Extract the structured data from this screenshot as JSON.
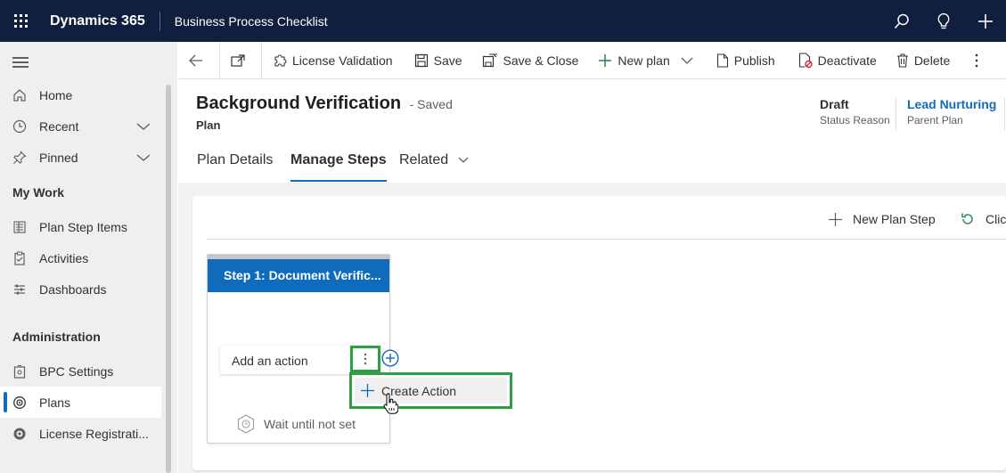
{
  "topbar": {
    "brand": "Dynamics 365",
    "app_title": "Business Process Checklist",
    "icons": [
      "search-icon",
      "lightbulb-icon",
      "plus-icon"
    ]
  },
  "sidebar": {
    "items_top": [
      {
        "label": "Home",
        "icon": "home-icon"
      },
      {
        "label": "Recent",
        "icon": "clock-icon",
        "expandable": true
      },
      {
        "label": "Pinned",
        "icon": "pin-icon",
        "expandable": true
      }
    ],
    "section_my_work": "My Work",
    "items_my_work": [
      {
        "label": "Plan Step Items",
        "icon": "list-icon"
      },
      {
        "label": "Activities",
        "icon": "clipboard-icon"
      },
      {
        "label": "Dashboards",
        "icon": "dashboard-icon"
      }
    ],
    "section_admin": "Administration",
    "items_admin": [
      {
        "label": "BPC Settings",
        "icon": "settings-icon"
      },
      {
        "label": "Plans",
        "icon": "plan-icon",
        "selected": true
      },
      {
        "label": "License Registrati...",
        "icon": "license-icon"
      }
    ]
  },
  "commandbar": {
    "license_validation": "License Validation",
    "save": "Save",
    "save_close": "Save & Close",
    "new_plan": "New plan",
    "publish": "Publish",
    "deactivate": "Deactivate",
    "delete": "Delete"
  },
  "record": {
    "title": "Background Verification",
    "saved_status": "- Saved",
    "entity": "Plan",
    "header_fields": [
      {
        "value": "Draft",
        "label": "Status Reason"
      },
      {
        "value": "Lead Nurturing",
        "label": "Parent Plan"
      }
    ]
  },
  "tabs": {
    "plan_details": "Plan Details",
    "manage_steps": "Manage Steps",
    "related": "Related"
  },
  "panel": {
    "new_plan_step": "New Plan Step",
    "clone_partial": "Clic"
  },
  "step": {
    "title": "Step 1: Document Verific...",
    "add_action": "Add an action",
    "wait_text": "Wait until not set"
  },
  "context_menu": {
    "create_action": "Create Action"
  },
  "colors": {
    "topbar": "#0f1f3d",
    "accent": "#0f6cbd",
    "highlight": "#2ea043"
  }
}
